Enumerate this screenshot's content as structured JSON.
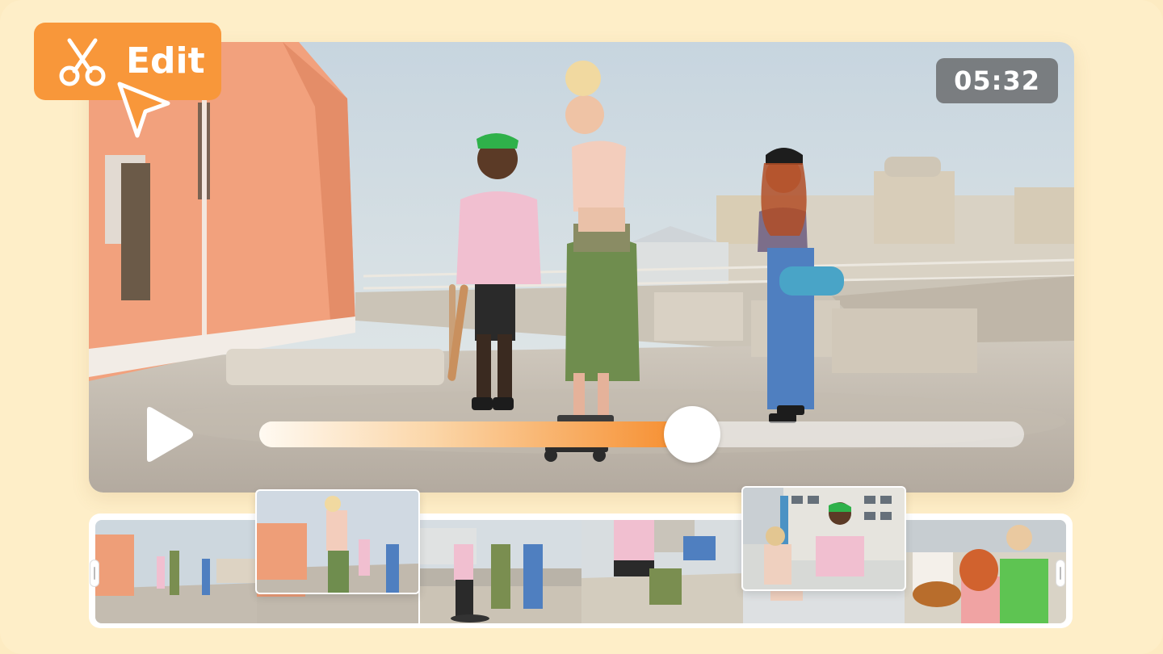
{
  "editor": {
    "edit_label": "Edit",
    "edit_icon": "scissors-icon",
    "cursor_icon": "pointer-cursor-icon"
  },
  "player": {
    "timestamp": "05:32",
    "play_icon": "play-icon",
    "progress_fraction": 0.566,
    "accent_color": "#f68b2a"
  },
  "filmstrip": {
    "frame_count": 6,
    "selected_frames": [
      2,
      5
    ]
  }
}
